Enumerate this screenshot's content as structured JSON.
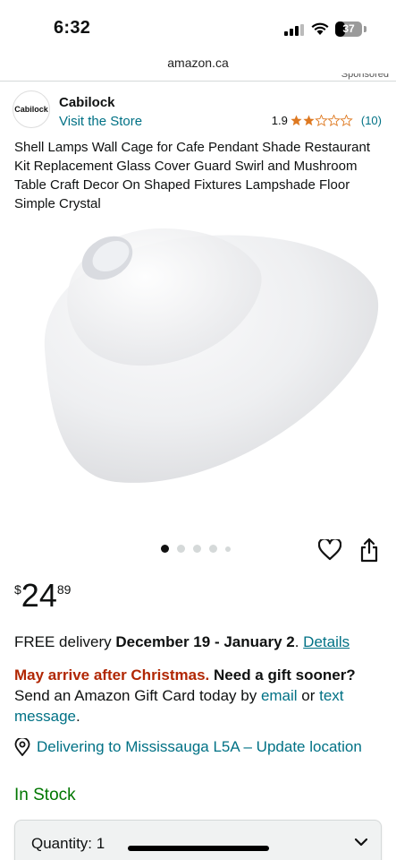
{
  "status_bar": {
    "time": "6:32",
    "battery": "37",
    "battery_level": 0.37
  },
  "url": "amazon.ca",
  "sponsored_label": "Sponsored",
  "brand": {
    "logo_text": "Cabilock",
    "name": "Cabilock",
    "visit_store": "Visit the Store"
  },
  "rating": {
    "value": "1.9",
    "stars_filled": 2,
    "stars_total": 5,
    "count": "(10)"
  },
  "product_title": "Shell Lamps Wall Cage for Cafe Pendant Shade Restaurant Kit Replacement Glass Cover Guard Swirl and Mushroom Table Craft Decor On Shaped Fixtures Lampshade Floor Simple Crystal",
  "carousel": {
    "total": 5,
    "active_index": 0
  },
  "price": {
    "symbol": "$",
    "whole": "24",
    "fraction": "89"
  },
  "delivery": {
    "prefix": "FREE delivery ",
    "dates": "December 19 - January 2",
    "period": ". ",
    "details_link": "Details"
  },
  "christmas": {
    "warning": "May arrive after Christmas.",
    "gift_question": " Need a gift sooner?",
    "send_text": "Send an Amazon Gift Card today by ",
    "email_link": "email",
    "or_text": " or ",
    "text_link": "text message",
    "end": "."
  },
  "location": {
    "text": "Delivering to Mississauga L5A – Update location"
  },
  "stock_status": "In Stock",
  "quantity": {
    "label": "Quantity:",
    "value": "1"
  },
  "icons": {
    "heart": "heart-icon",
    "share": "share-icon",
    "pin": "location-pin-icon",
    "chevron": "chevron-down-icon"
  },
  "colors": {
    "link": "#007185",
    "star": "#de7921",
    "warning": "#b12704",
    "in_stock": "#007600"
  }
}
